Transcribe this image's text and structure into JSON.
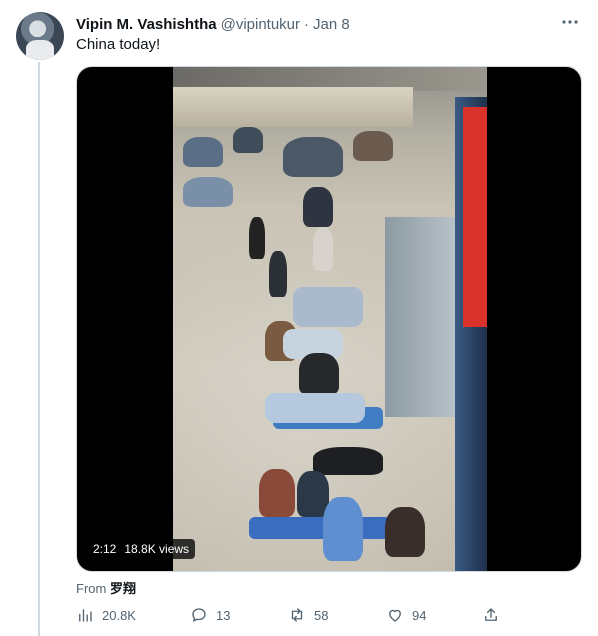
{
  "tweet": {
    "display_name": "Vipin M. Vashishtha",
    "handle": "@vipintukur",
    "separator": "·",
    "date": "Jan 8",
    "text": "China today!",
    "more_icon": "more-horizontal-icon"
  },
  "media": {
    "type": "video",
    "duration": "2:12",
    "views": "18.8K views"
  },
  "source": {
    "label": "From",
    "name": "罗翔"
  },
  "actions": {
    "views": {
      "icon": "bar-chart-icon",
      "count": "20.8K"
    },
    "reply": {
      "icon": "reply-icon",
      "count": "13"
    },
    "retweet": {
      "icon": "retweet-icon",
      "count": "58"
    },
    "like": {
      "icon": "heart-icon",
      "count": "94"
    },
    "share": {
      "icon": "share-icon",
      "count": ""
    }
  },
  "colors": {
    "text_primary": "#0f1419",
    "text_secondary": "#536471",
    "border": "#cfd9de"
  }
}
